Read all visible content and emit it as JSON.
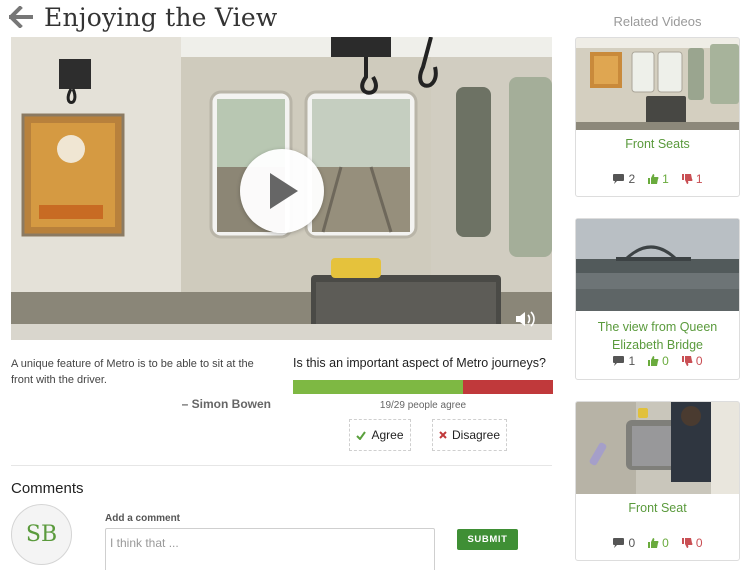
{
  "header": {
    "title": "Enjoying the View"
  },
  "video": {
    "caption": "A unique feature of Metro is to be able to sit at the front with the driver.",
    "author": "– Simon Bowen"
  },
  "poll": {
    "question": "Is this an important aspect of Metro journeys?",
    "agree_fraction": 0.655,
    "agree_count_text": "19/29 people agree",
    "agree_label": "Agree",
    "disagree_label": "Disagree",
    "colors": {
      "agree": "#7eb843",
      "disagree": "#c0393b"
    }
  },
  "comments": {
    "heading": "Comments",
    "avatar_initials": "SB",
    "add_label": "Add a comment",
    "input_placeholder": "I think that ...",
    "submit_label": "SUBMIT"
  },
  "related": {
    "heading": "Related Videos",
    "items": [
      {
        "title": "Front Seats",
        "comments": "2",
        "likes": "1",
        "dislikes": "1"
      },
      {
        "title": "The view from Queen Elizabeth Bridge",
        "comments": "1",
        "likes": "0",
        "dislikes": "0"
      },
      {
        "title": "Front Seat",
        "comments": "0",
        "likes": "0",
        "dislikes": "0"
      }
    ]
  }
}
